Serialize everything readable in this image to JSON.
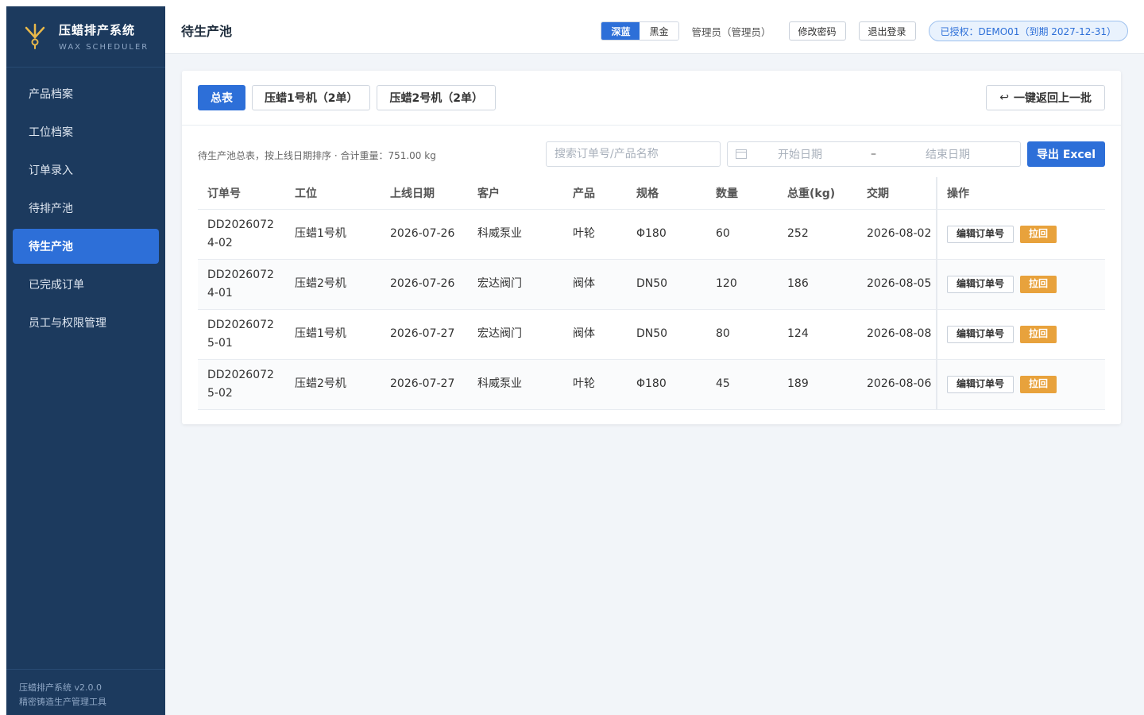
{
  "brand": {
    "title": "压蜡排产系统",
    "subtitle": "WAX SCHEDULER"
  },
  "sidebar": {
    "items": [
      {
        "label": "产品档案",
        "active": false
      },
      {
        "label": "工位档案",
        "active": false
      },
      {
        "label": "订单录入",
        "active": false
      },
      {
        "label": "待排产池",
        "active": false
      },
      {
        "label": "待生产池",
        "active": true
      },
      {
        "label": "已完成订单",
        "active": false
      },
      {
        "label": "员工与权限管理",
        "active": false
      }
    ],
    "footer_version": "压蜡排产系统 v2.0.0",
    "footer_desc": "精密铸造生产管理工具"
  },
  "header": {
    "title": "待生产池",
    "theme_options": [
      "深蓝",
      "黑金"
    ],
    "user": "管理员（管理员）",
    "change_password": "修改密码",
    "logout": "退出登录",
    "license": "已授权：DEMO01（到期 2027-12-31）"
  },
  "tabs": [
    "总表",
    "压蜡1号机（2单）",
    "压蜡2号机（2单）"
  ],
  "back_button": "一键返回上一批",
  "summary": "待生产池总表，按上线日期排序 · 合计重量：751.00 kg",
  "search": {
    "placeholder": "搜索订单号/产品名称"
  },
  "date_range": {
    "start_placeholder": "开始日期",
    "separator": "–",
    "end_placeholder": "结束日期"
  },
  "export_button": "导出 Excel",
  "table": {
    "headers": [
      "订单号",
      "工位",
      "上线日期",
      "客户",
      "产品",
      "规格",
      "数量",
      "总重(kg)",
      "交期",
      "操作"
    ],
    "rows": [
      {
        "order_a": "DD2026072",
        "order_b": "4-02",
        "station": "压蜡1号机",
        "online": "2026-07-26",
        "customer": "科威泵业",
        "product": "叶轮",
        "spec": "Φ180",
        "qty": "60",
        "weight": "252",
        "due": "2026-08-02"
      },
      {
        "order_a": "DD2026072",
        "order_b": "4-01",
        "station": "压蜡2号机",
        "online": "2026-07-26",
        "customer": "宏达阀门",
        "product": "阀体",
        "spec": "DN50",
        "qty": "120",
        "weight": "186",
        "due": "2026-08-05"
      },
      {
        "order_a": "DD2026072",
        "order_b": "5-01",
        "station": "压蜡1号机",
        "online": "2026-07-27",
        "customer": "宏达阀门",
        "product": "阀体",
        "spec": "DN50",
        "qty": "80",
        "weight": "124",
        "due": "2026-08-08"
      },
      {
        "order_a": "DD2026072",
        "order_b": "5-02",
        "station": "压蜡2号机",
        "online": "2026-07-27",
        "customer": "科威泵业",
        "product": "叶轮",
        "spec": "Φ180",
        "qty": "45",
        "weight": "189",
        "due": "2026-08-06"
      }
    ],
    "op_edit": "编辑订单号",
    "op_pull": "拉回"
  },
  "colors": {
    "sidebar": "#1c3a5e",
    "accent": "#2d6fd8",
    "warning": "#e8a23c"
  }
}
